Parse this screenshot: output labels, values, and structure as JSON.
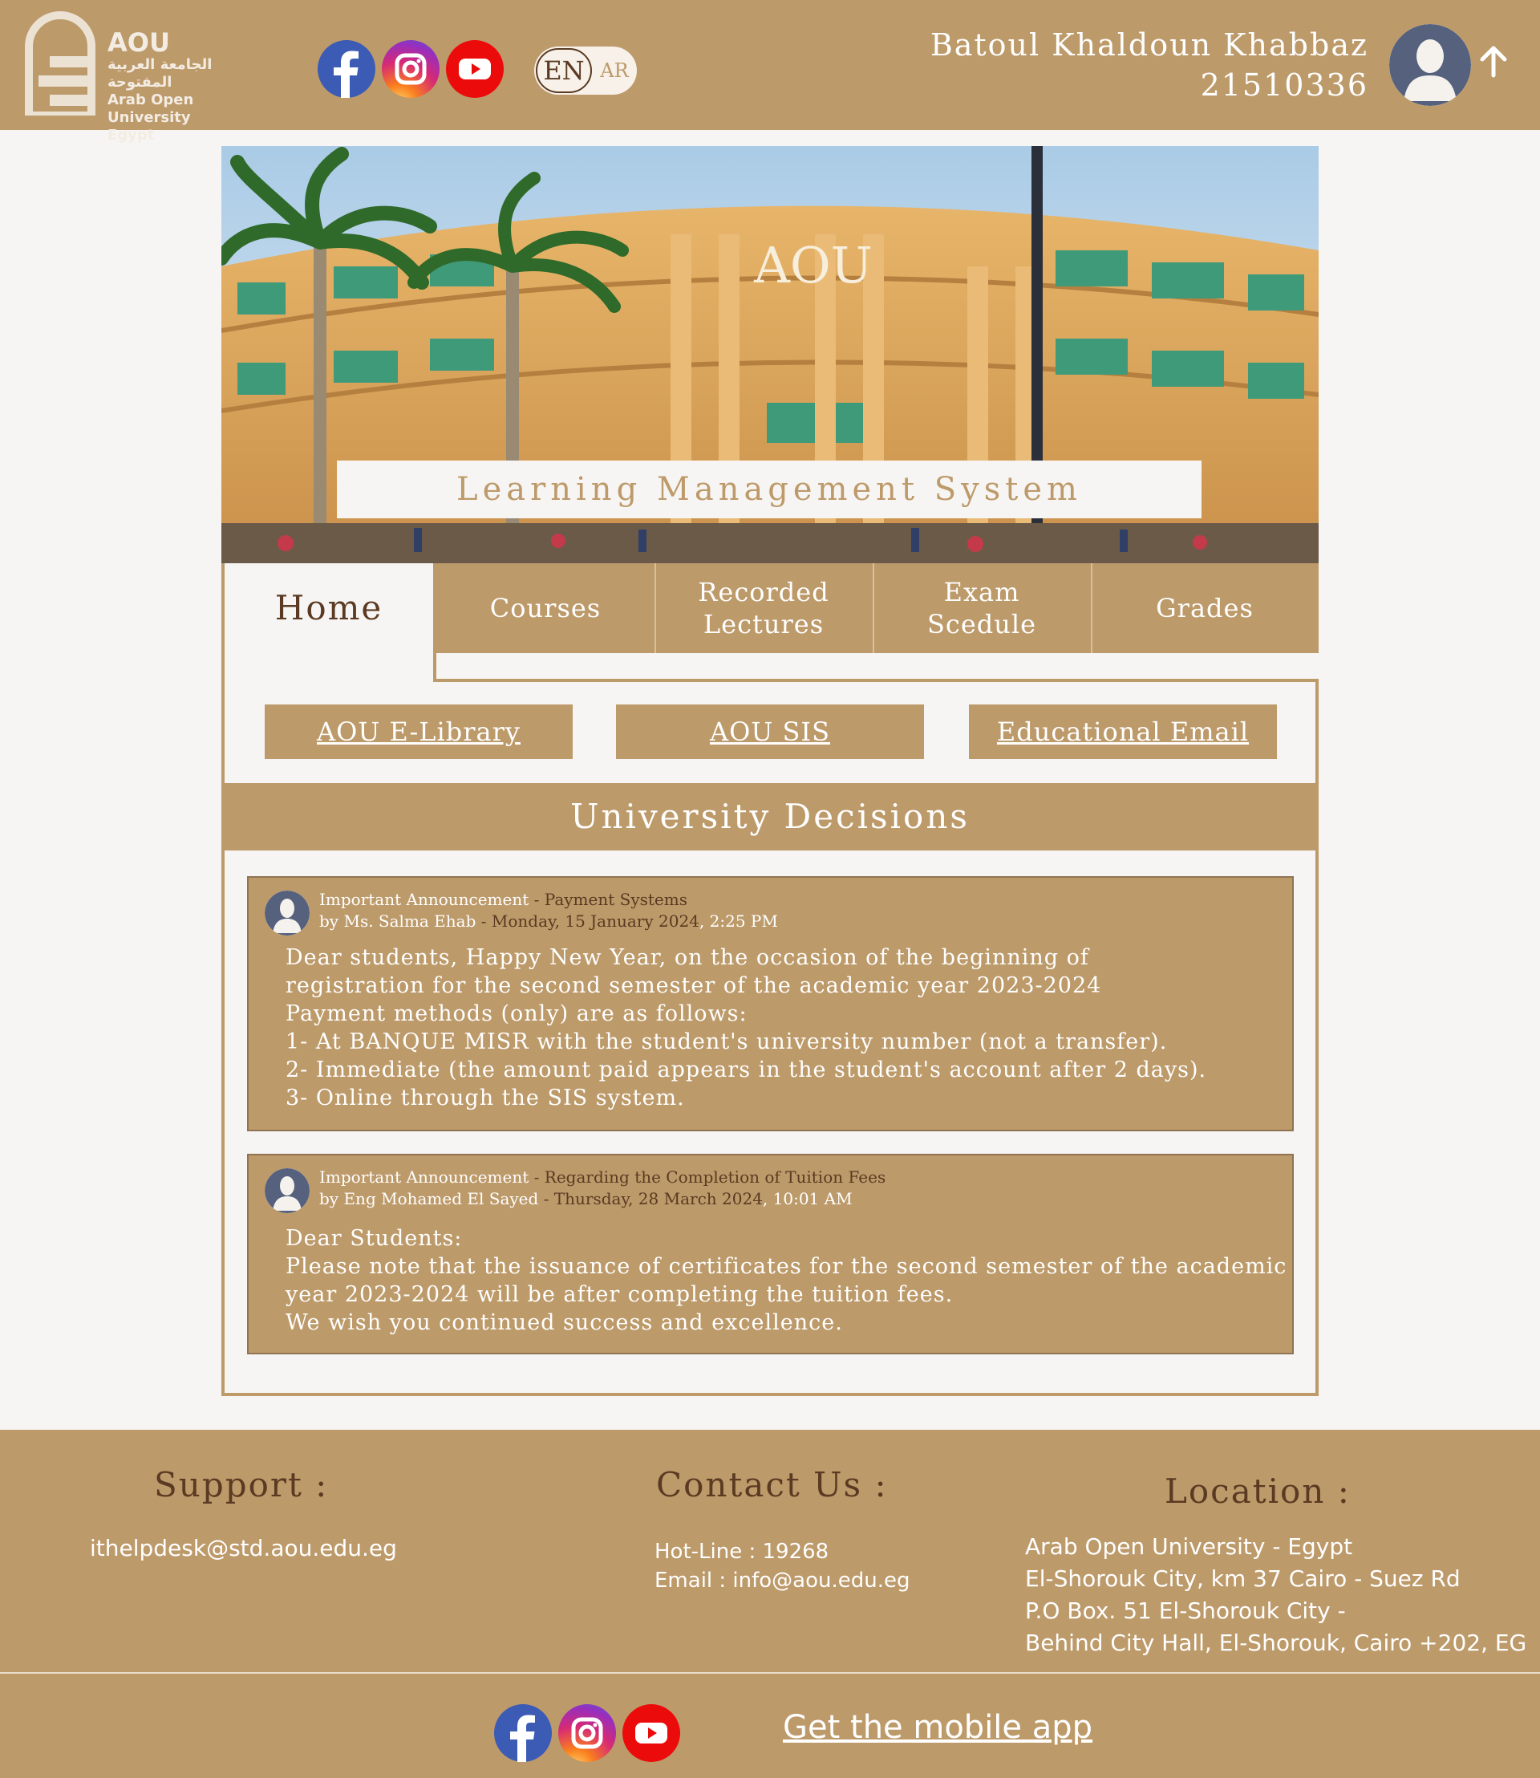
{
  "header": {
    "logo": {
      "abbr": "AOU",
      "arabic_name": "الجامعة العربية المفتوحة",
      "english_name": "Arab Open University",
      "country": "Egypt"
    },
    "social_icons": [
      "facebook-icon",
      "instagram-icon",
      "youtube-icon"
    ],
    "language": {
      "en": "EN",
      "ar": "AR",
      "selected": "EN"
    },
    "user": {
      "name": "Batoul Khaldoun Khabbaz",
      "id": "21510336"
    }
  },
  "hero": {
    "banner_text": "AOU",
    "title": "Learning Management System"
  },
  "nav": {
    "tabs": [
      {
        "label": "Home",
        "active": true
      },
      {
        "label": "Courses"
      },
      {
        "label": "Recorded Lectures"
      },
      {
        "label": "Exam Scedule"
      },
      {
        "label": "Grades"
      }
    ]
  },
  "quick_links": [
    "AOU E-Library",
    "AOU SIS",
    "Educational Email"
  ],
  "decisions": {
    "title": "University Decisions",
    "announcements": [
      {
        "type": "Important Announcement",
        "subject": "Payment Systems",
        "author": "by Ms. Salma Ehab",
        "date": "Monday, 15 January 2024",
        "time": "2:25 PM",
        "lines": [
          "Dear students, Happy New Year, on the occasion of the beginning of",
          "registration for the second semester of the academic year 2023-2024",
          "Payment methods (only) are as follows:",
          "1- At BANQUE MISR with the student's university number (not a transfer).",
          "2- Immediate (the amount paid appears in the student's account after 2 days).",
          "3- Online through the SIS system."
        ]
      },
      {
        "type": "Important Announcement",
        "subject": "Regarding the Completion of Tuition Fees",
        "author": "by Eng Mohamed El Sayed",
        "date": "Thursday, 28 March 2024",
        "time": "10:01 AM",
        "lines": [
          "Dear Students:",
          "Please note that the issuance of certificates for the second semester of the academic",
          "year 2023-2024 will be after completing the tuition fees.",
          "We wish you continued success and excellence."
        ]
      }
    ]
  },
  "footer": {
    "support": {
      "title": "Support :",
      "email": "ithelpdesk@std.aou.edu.eg"
    },
    "contact": {
      "title": "Contact Us :",
      "hotline": "Hot-Line : 19268",
      "email": "Email : info@aou.edu.eg"
    },
    "location": {
      "title": "Location :",
      "lines": [
        "Arab Open University - Egypt",
        "El-Shorouk City, km 37 Cairo - Suez Rd",
        "P.O Box. 51 El-Shorouk City -",
        "Behind City Hall, El-Shorouk, Cairo +202, EG"
      ]
    },
    "mobile_app": "Get the mobile app"
  },
  "colors": {
    "primary": "#bd9a6a",
    "dark_brown": "#5a3a22",
    "background": "#f7f5f3"
  }
}
